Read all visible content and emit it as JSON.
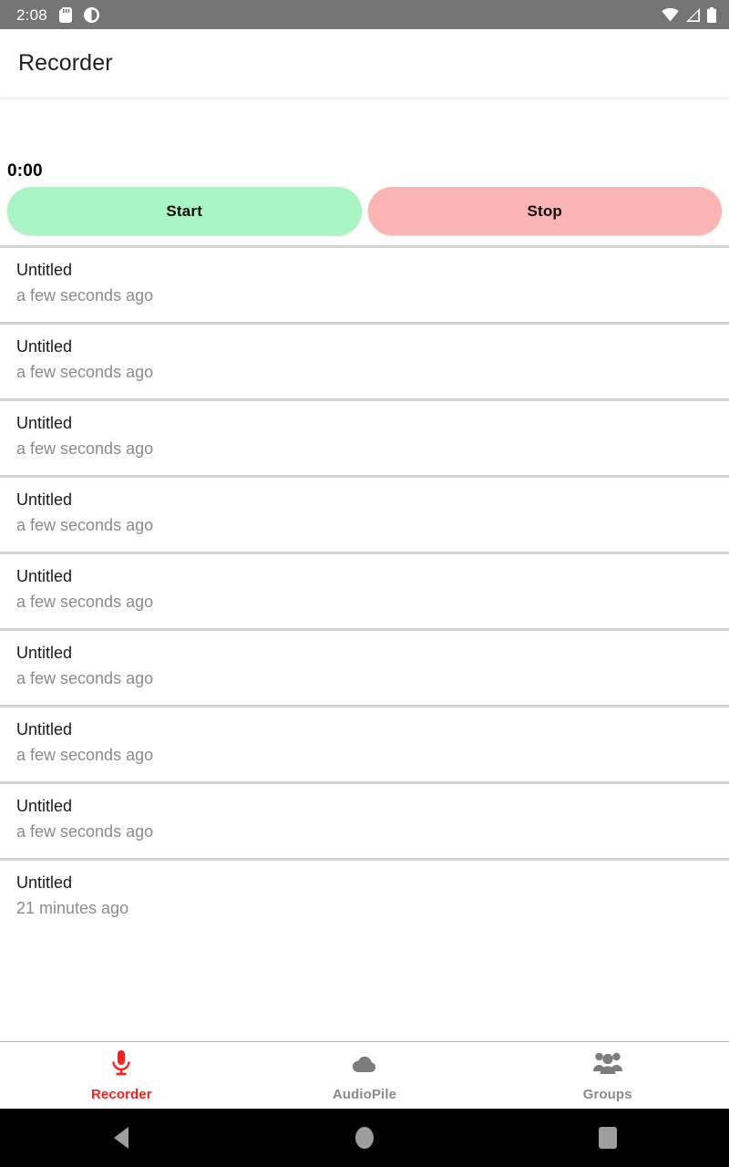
{
  "status_bar": {
    "time": "2:08",
    "left_icons": [
      "sd-card-icon",
      "contrast-circle-icon"
    ],
    "right_icons": [
      "wifi-icon",
      "cellular-signal-icon",
      "battery-icon"
    ],
    "background_color": "#757575"
  },
  "app_bar": {
    "title": "Recorder"
  },
  "recorder": {
    "timer": "0:00",
    "start_label": "Start",
    "stop_label": "Stop",
    "start_color": "#aaf5c4",
    "stop_color": "#fbb4b4"
  },
  "recordings": [
    {
      "title": "Untitled",
      "subtitle": "a few seconds ago"
    },
    {
      "title": "Untitled",
      "subtitle": "a few seconds ago"
    },
    {
      "title": "Untitled",
      "subtitle": "a few seconds ago"
    },
    {
      "title": "Untitled",
      "subtitle": "a few seconds ago"
    },
    {
      "title": "Untitled",
      "subtitle": "a few seconds ago"
    },
    {
      "title": "Untitled",
      "subtitle": "a few seconds ago"
    },
    {
      "title": "Untitled",
      "subtitle": "a few seconds ago"
    },
    {
      "title": "Untitled",
      "subtitle": "a few seconds ago"
    },
    {
      "title": "Untitled",
      "subtitle": "21 minutes ago"
    }
  ],
  "bottom_nav": {
    "active_color": "#f4241d",
    "inactive_color": "#8a8a8a",
    "items": [
      {
        "label": "Recorder",
        "icon": "microphone-icon",
        "active": true
      },
      {
        "label": "AudioPile",
        "icon": "cloud-icon",
        "active": false
      },
      {
        "label": "Groups",
        "icon": "people-group-icon",
        "active": false
      }
    ]
  },
  "system_nav": {
    "buttons": [
      "back-button",
      "home-button",
      "recents-button"
    ]
  }
}
